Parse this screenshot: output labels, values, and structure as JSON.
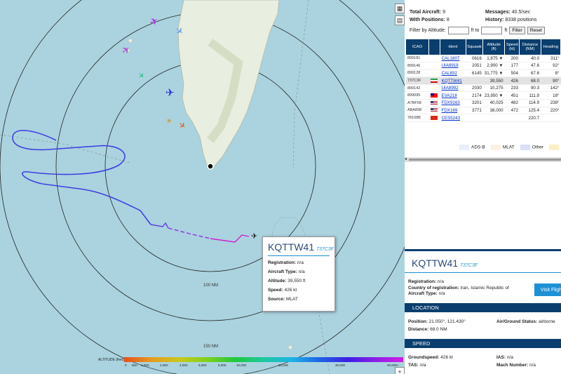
{
  "stats": {
    "total_aircraft_label": "Total Aircraft:",
    "total_aircraft": "9",
    "messages_label": "Messages:",
    "messages": "40.5/sec",
    "with_positions_label": "With Positions:",
    "with_positions": "8",
    "history_label": "History:",
    "history": "8338 positions"
  },
  "filter": {
    "label": "Filter by Altitude:",
    "ft1": "ft to",
    "ft2": "ft",
    "filter_button": "Filter",
    "reset_button": "Reset"
  },
  "table": {
    "headers": [
      "ICAO",
      "",
      "Ident",
      "Squawk",
      "Altitude (ft)",
      "Speed (kt)",
      "Distance (NM)",
      "Heading"
    ],
    "rows": [
      {
        "icao": "899181",
        "flag": "",
        "ident": "CAL1807",
        "squawk": "0616",
        "alt": "1,875 ▼",
        "speed": "200",
        "dist": "40.0",
        "hdg": "311°"
      },
      {
        "icao": "899146",
        "flag": "",
        "ident": "UIA8918",
        "squawk": "2051",
        "alt": "2,900 ▼",
        "speed": "177",
        "dist": "47.6",
        "hdg": "92°"
      },
      {
        "icao": "899128",
        "flag": "",
        "ident": "CAL832",
        "squawk": "6145",
        "alt": "31,775 ▼",
        "speed": "504",
        "dist": "67.6",
        "hdg": "8°"
      },
      {
        "icao": "737C3F",
        "flag": "ir",
        "ident": "KQTTW41",
        "squawk": "",
        "alt": "39,550",
        "speed": "426",
        "dist": "68.0",
        "hdg": "90°"
      },
      {
        "icao": "899142",
        "flag": "",
        "ident": "UIA8992",
        "squawk": "2030",
        "alt": "10,275",
        "speed": "233",
        "dist": "90.3",
        "hdg": "142°"
      },
      {
        "icao": "899095",
        "flag": "tw",
        "ident": "EVA218",
        "squawk": "2174",
        "alt": "23,950 ▼",
        "speed": "451",
        "dist": "111.9",
        "hdg": "18°"
      },
      {
        "icao": "A7BF58",
        "flag": "us",
        "ident": "FDX9163",
        "squawk": "3201",
        "alt": "40,025",
        "speed": "482",
        "dist": "114.9",
        "hdg": "238°"
      },
      {
        "icao": "ABA898",
        "flag": "us",
        "ident": "FDX169",
        "squawk": "3771",
        "alt": "38,000",
        "speed": "472",
        "dist": "125.4",
        "hdg": "220°"
      },
      {
        "icao": "78108B",
        "flag": "cn",
        "ident": "CES5243",
        "squawk": "",
        "alt": "",
        "speed": "",
        "dist": "220.7",
        "hdg": ""
      }
    ]
  },
  "source_legend": {
    "adsb": "ADS-B",
    "mlat": "MLAT",
    "other": "Other"
  },
  "selected": {
    "ident": "KQTTW41",
    "icao": "737C3F",
    "registration_label": "Registration:",
    "registration": "n/a",
    "country_label": "Country of registration:",
    "country": "Iran, Islamic Republic of",
    "type_label": "Aircraft Type:",
    "type": "n/a",
    "visit_button": "Visit Flight",
    "location_header": "LOCATION",
    "position_label": "Position:",
    "position": "21.050°, 121.430°",
    "airground_label": "Air/Ground Status:",
    "airground": "airborne",
    "distance_label": "Distance:",
    "distance": "68.0 NM",
    "speed_header": "SPEED",
    "groundspeed_label": "Groundspeed:",
    "groundspeed": "426 kt",
    "ias_label": "IAS:",
    "ias": "n/a",
    "tas_label": "TAS:",
    "tas": "n/a",
    "mach_label": "Mach Number:",
    "mach": "n/a"
  },
  "popup": {
    "ident": "KQTTW41",
    "icao": "737C3F",
    "registration_label": "Registration:",
    "registration": "n/a",
    "type_label": "Aircraft Type:",
    "type": "n/a",
    "altitude_label": "Altitude:",
    "altitude": "39,550 ft",
    "speed_label": "Speed:",
    "speed": "426 kt",
    "source_label": "Source:",
    "source": "MLAT"
  },
  "map": {
    "ring_100": "100 NM",
    "ring_150": "150 NM"
  },
  "altitude_legend": {
    "label": "ALTITUDE (feet)",
    "ticks": [
      "0",
      "500",
      "1,000",
      "2,000",
      "4,000",
      "6,000",
      "8,000",
      "10,000",
      "20,000",
      "30,000",
      "40,000+"
    ]
  },
  "colors": {
    "header_blue": "#0a3e6e",
    "accent_blue": "#1e90d6",
    "sea": "#aad3df",
    "land": "#f2efe9",
    "track_purple": "#4040e0",
    "track_magenta": "#d020d0"
  }
}
